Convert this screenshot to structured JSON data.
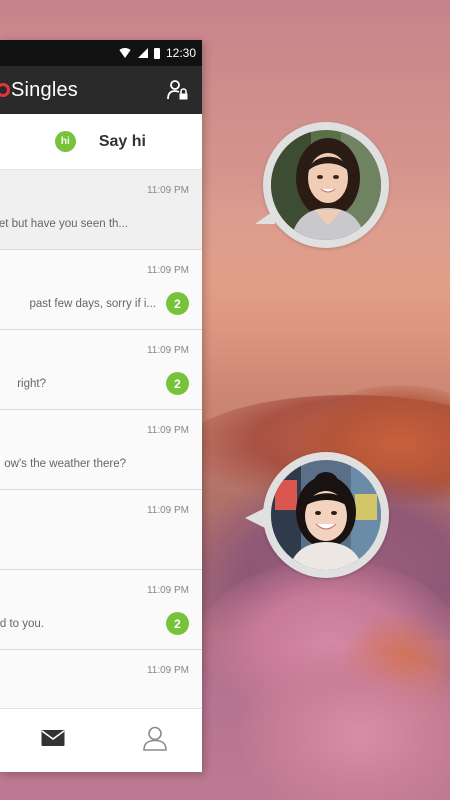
{
  "status_bar": {
    "time": "12:30"
  },
  "app_bar": {
    "brand": "Singles"
  },
  "say_hi": {
    "badge": "hi",
    "label": "Say hi"
  },
  "conversations": [
    {
      "time": "11:09 PM",
      "preview": "et but have you seen th...",
      "badge": null
    },
    {
      "time": "11:09 PM",
      "preview": "past few days, sorry if i...",
      "badge": "2"
    },
    {
      "time": "11:09 PM",
      "preview": "right?",
      "badge": "2"
    },
    {
      "time": "11:09 PM",
      "preview": "ow's the weather there?",
      "badge": null
    },
    {
      "time": "11:09 PM",
      "preview": "",
      "badge": null
    },
    {
      "time": "11:09 PM",
      "preview": "d to you.",
      "badge": "2"
    },
    {
      "time": "11:09 PM",
      "preview": "",
      "badge": null
    }
  ],
  "colors": {
    "accent_green": "#77c43a",
    "app_bar_bg": "#2a2a2a",
    "brand_mark": "#e2363a"
  },
  "icons": {
    "status": [
      "wifi-icon",
      "signal-icon",
      "battery-icon"
    ],
    "app_bar": "account-lock-icon",
    "bottom_nav": [
      "mail-icon",
      "profile-icon"
    ]
  }
}
